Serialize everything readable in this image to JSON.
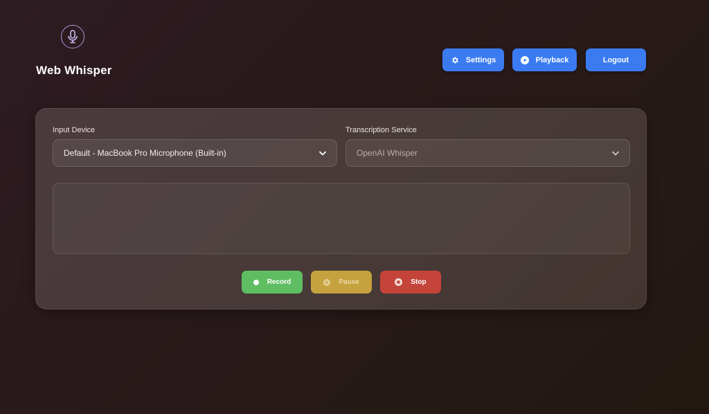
{
  "app": {
    "title": "Web Whisper",
    "logo_icon": "microphone-icon"
  },
  "nav": {
    "settings_label": "Settings",
    "playback_label": "Playback",
    "logout_label": "Logout",
    "settings_icon": "gear-icon",
    "playback_icon": "play-icon"
  },
  "form": {
    "input_device_label": "Input Device",
    "input_device_value": "Default - MacBook Pro Microphone (Built-in)",
    "service_label": "Transcription Service",
    "service_value": "OpenAI Whisper"
  },
  "transcript": {
    "text": ""
  },
  "controls": {
    "record_label": "Record",
    "pause_label": "Pause",
    "stop_label": "Stop"
  },
  "colors": {
    "primary": "#3b7bf1",
    "record": "#5fbe62",
    "pause": "#c6a23e",
    "stop": "#c5443a",
    "logo_accent": "#a89ad4"
  }
}
